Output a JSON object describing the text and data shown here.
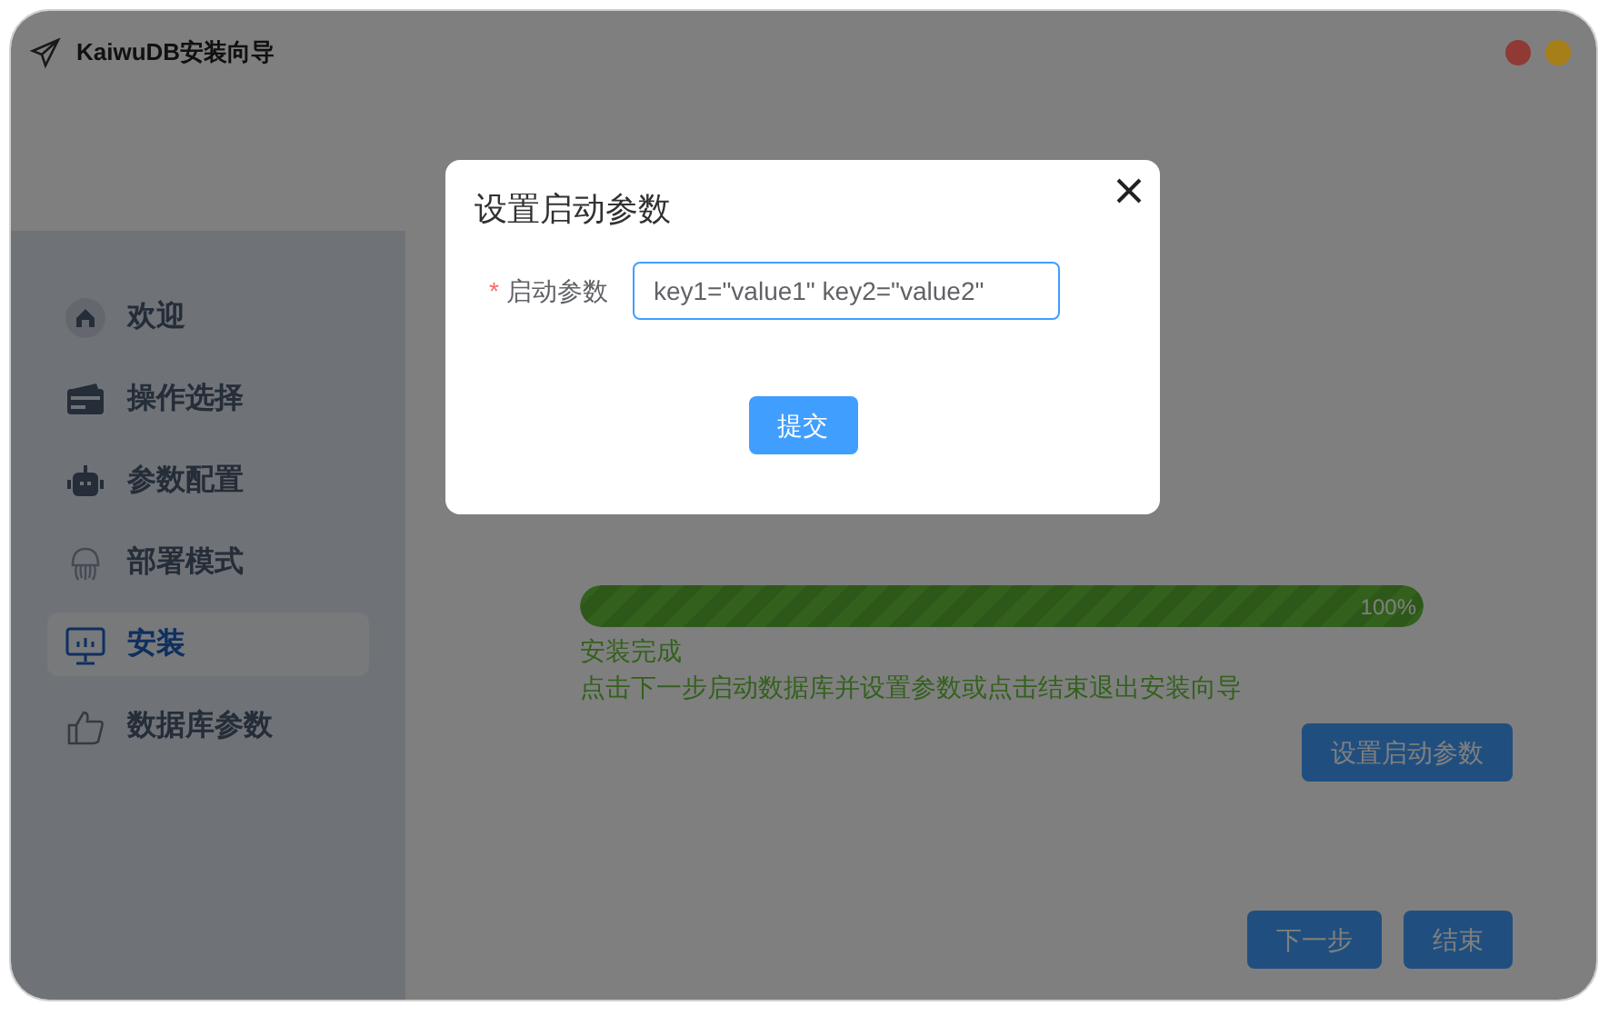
{
  "window": {
    "title": "KaiwuDB安装向导",
    "controls": [
      {
        "color": "#8f3a35"
      },
      {
        "color": "#a67f18"
      }
    ]
  },
  "sidebar": {
    "items": [
      {
        "label": "欢迎",
        "selected": false
      },
      {
        "label": "操作选择",
        "selected": false
      },
      {
        "label": "参数配置",
        "selected": false
      },
      {
        "label": "部署模式",
        "selected": false
      },
      {
        "label": "安装",
        "selected": true
      },
      {
        "label": "数据库参数",
        "selected": false
      }
    ]
  },
  "progress": {
    "level": 1,
    "label": "100%"
  },
  "status": [
    "安装完成",
    "点击下一步启动数据库并设置参数或点击结束退出安装向导"
  ],
  "set_params_button": "设置启动参数",
  "footer_buttons": [
    "下一步",
    "结束"
  ],
  "dialog": {
    "title": "设置启动参数",
    "field": {
      "label": "启动参数",
      "required_mark": "*",
      "value": "key1=\"value1\" key2=\"value2\""
    },
    "submit": "提交"
  }
}
